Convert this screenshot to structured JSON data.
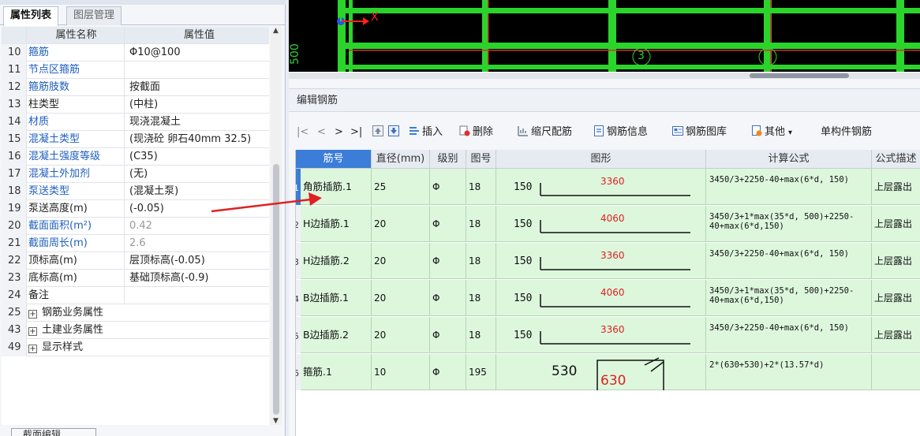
{
  "left_panel": {
    "tabs": [
      "属性列表",
      "图层管理"
    ],
    "headers": {
      "name": "属性名称",
      "value": "属性值"
    },
    "rows": [
      {
        "num": "10",
        "name": "箍筋",
        "value": "Φ10@100",
        "blue": true,
        "gray_value": false
      },
      {
        "num": "11",
        "name": "节点区箍筋",
        "value": "",
        "blue": true,
        "gray_value": false
      },
      {
        "num": "12",
        "name": "箍筋肢数",
        "value": "按截面",
        "blue": true,
        "gray_value": false
      },
      {
        "num": "13",
        "name": "柱类型",
        "value": "(中柱)",
        "blue": false,
        "gray_value": false
      },
      {
        "num": "14",
        "name": "材质",
        "value": "现浇混凝土",
        "blue": true,
        "gray_value": false
      },
      {
        "num": "15",
        "name": "混凝土类型",
        "value": "(现浇砼 卵石40mm 32.5)",
        "blue": true,
        "gray_value": false
      },
      {
        "num": "16",
        "name": "混凝土强度等级",
        "value": "(C35)",
        "blue": true,
        "gray_value": false
      },
      {
        "num": "17",
        "name": "混凝土外加剂",
        "value": "(无)",
        "blue": true,
        "gray_value": false
      },
      {
        "num": "18",
        "name": "泵送类型",
        "value": "(混凝土泵)",
        "blue": true,
        "gray_value": false
      },
      {
        "num": "19",
        "name": "泵送高度(m)",
        "value": "(-0.05)",
        "blue": false,
        "gray_value": false
      },
      {
        "num": "20",
        "name": "截面面积(m²)",
        "value": "0.42",
        "blue": true,
        "gray_value": true
      },
      {
        "num": "21",
        "name": "截面周长(m)",
        "value": "2.6",
        "blue": true,
        "gray_value": true
      },
      {
        "num": "22",
        "name": "顶标高(m)",
        "value": "层顶标高(-0.05)",
        "blue": false,
        "gray_value": false
      },
      {
        "num": "23",
        "name": "底标高(m)",
        "value": "基础顶标高(-0.9)",
        "blue": false,
        "gray_value": false
      },
      {
        "num": "24",
        "name": "备注",
        "value": "",
        "blue": false,
        "gray_value": false
      }
    ],
    "groups": [
      {
        "num": "25",
        "name": "钢筋业务属性"
      },
      {
        "num": "43",
        "name": "土建业务属性"
      },
      {
        "num": "49",
        "name": "显示样式"
      }
    ],
    "bottom_button": "截面编辑"
  },
  "viewport": {
    "axis_label": "X",
    "dimension": "500",
    "axis_markers": [
      "3",
      "4"
    ]
  },
  "editor": {
    "title": "编辑钢筋",
    "toolbar": {
      "nav": [
        "|<",
        "<",
        ">",
        ">|"
      ],
      "insert": "插入",
      "delete": "删除",
      "scale_rebar": "缩尺配筋",
      "rebar_info": "钢筋信息",
      "rebar_library": "钢筋图库",
      "other": "其他",
      "single_member": "单构件钢筋"
    },
    "columns": [
      "筋号",
      "直径(mm)",
      "级别",
      "图号",
      "图形",
      "计算公式",
      "公式描述"
    ],
    "rows": [
      {
        "index": "1",
        "name": "角筋插筋.1",
        "diameter": "25",
        "grade": "Φ",
        "shape_no": "18",
        "left_len": "150",
        "right_len": "3360",
        "formula": "3450/3+2250-40+max(6*d, 150)",
        "desc": "上层露出"
      },
      {
        "index": "2",
        "name": "H边插筋.1",
        "diameter": "20",
        "grade": "Φ",
        "shape_no": "18",
        "left_len": "150",
        "right_len": "4060",
        "formula": "3450/3+1*max(35*d, 500)+2250-40+max(6*d,150)",
        "desc": "上层露出"
      },
      {
        "index": "3",
        "name": "H边插筋.2",
        "diameter": "20",
        "grade": "Φ",
        "shape_no": "18",
        "left_len": "150",
        "right_len": "3360",
        "formula": "3450/3+2250-40+max(6*d, 150)",
        "desc": "上层露出"
      },
      {
        "index": "4",
        "name": "B边插筋.1",
        "diameter": "20",
        "grade": "Φ",
        "shape_no": "18",
        "left_len": "150",
        "right_len": "4060",
        "formula": "3450/3+1*max(35*d, 500)+2250-40+max(6*d,150)",
        "desc": "上层露出"
      },
      {
        "index": "5",
        "name": "B边插筋.2",
        "diameter": "20",
        "grade": "Φ",
        "shape_no": "18",
        "left_len": "150",
        "right_len": "3360",
        "formula": "3450/3+2250-40+max(6*d, 150)",
        "desc": "上层露出"
      },
      {
        "index": "6",
        "name": "箍筋.1",
        "diameter": "10",
        "grade": "Φ",
        "shape_no": "195",
        "left_len": "530",
        "right_len": "630",
        "formula": "2*(630+530)+2*(13.57*d)",
        "desc": ""
      }
    ]
  },
  "colors": {
    "accent": "#3b7dd8",
    "row_bg": "#ddf7dd",
    "rebar_green": "#2bd42b",
    "red": "#e02020"
  }
}
